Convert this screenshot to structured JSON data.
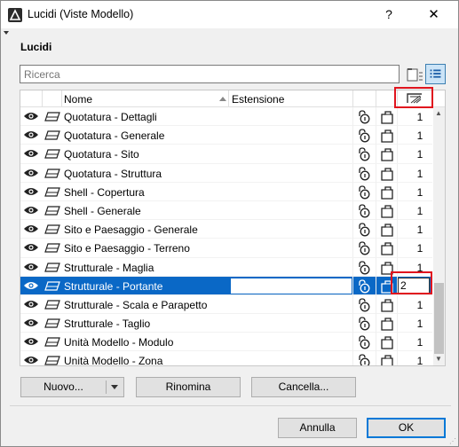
{
  "window": {
    "title": "Lucidi (Viste Modello)",
    "help_label": "?",
    "close_label": "✕"
  },
  "section": {
    "title": "Lucidi"
  },
  "search": {
    "placeholder": "Ricerca"
  },
  "table": {
    "col_name": "Nome",
    "col_ext": "Estensione",
    "rows": [
      {
        "name": "Quotatura - Dettagli",
        "pen": "1"
      },
      {
        "name": "Quotatura - Generale",
        "pen": "1"
      },
      {
        "name": "Quotatura - Sito",
        "pen": "1"
      },
      {
        "name": "Quotatura - Struttura",
        "pen": "1"
      },
      {
        "name": "Shell - Copertura",
        "pen": "1"
      },
      {
        "name": "Shell - Generale",
        "pen": "1"
      },
      {
        "name": "Sito e Paesaggio - Generale",
        "pen": "1"
      },
      {
        "name": "Sito e Paesaggio - Terreno",
        "pen": "1"
      },
      {
        "name": "Strutturale - Maglia",
        "pen": "1"
      },
      {
        "name": "Strutturale - Portante",
        "pen": "2",
        "selected": true
      },
      {
        "name": "Strutturale - Scala e Parapetto",
        "pen": "1"
      },
      {
        "name": "Strutturale - Taglio",
        "pen": "1"
      },
      {
        "name": "Unità Modello - Modulo",
        "pen": "1"
      },
      {
        "name": "Unità Modello - Zona",
        "pen": "1"
      }
    ]
  },
  "buttons": {
    "new": "Nuovo...",
    "rename": "Rinomina",
    "delete": "Cancella...",
    "cancel": "Annulla",
    "ok": "OK"
  },
  "icons": {
    "visibility": "eye-icon",
    "layer": "layer-icon",
    "lock": "lock-icon",
    "document": "document-icon",
    "pen_set": "pen-weight-icon"
  },
  "colors": {
    "selection": "#0a68c6",
    "highlight_box": "#e0141e"
  }
}
